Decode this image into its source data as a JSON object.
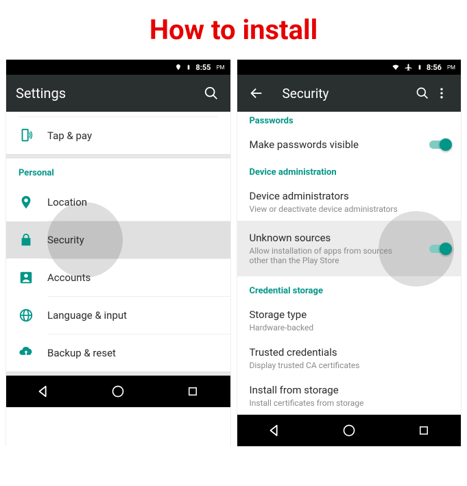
{
  "header": {
    "title": "How to install"
  },
  "left": {
    "status": {
      "time": "8:55",
      "ampm": "PM"
    },
    "appbar": {
      "title": "Settings"
    },
    "items": {
      "tap_pay": "Tap & pay",
      "personal": "Personal",
      "location": "Location",
      "security": "Security",
      "accounts": "Accounts",
      "language": "Language & input",
      "backup": "Backup & reset"
    }
  },
  "right": {
    "status": {
      "time": "8:56",
      "ampm": "PM"
    },
    "appbar": {
      "title": "Security"
    },
    "sections": {
      "passwords": "Passwords",
      "make_passwords_visible": "Make passwords visible",
      "device_admin": "Device administration",
      "device_admins": {
        "title": "Device administrators",
        "sub": "View or deactivate device administrators"
      },
      "unknown": {
        "title": "Unknown sources",
        "sub": "Allow installation of apps from sources other than the Play Store"
      },
      "cred_storage": "Credential storage",
      "storage_type": {
        "title": "Storage type",
        "sub": "Hardware-backed"
      },
      "trusted": {
        "title": "Trusted credentials",
        "sub": "Display trusted CA certificates"
      },
      "install": {
        "title": "Install from storage",
        "sub": "Install certificates from storage"
      }
    }
  }
}
